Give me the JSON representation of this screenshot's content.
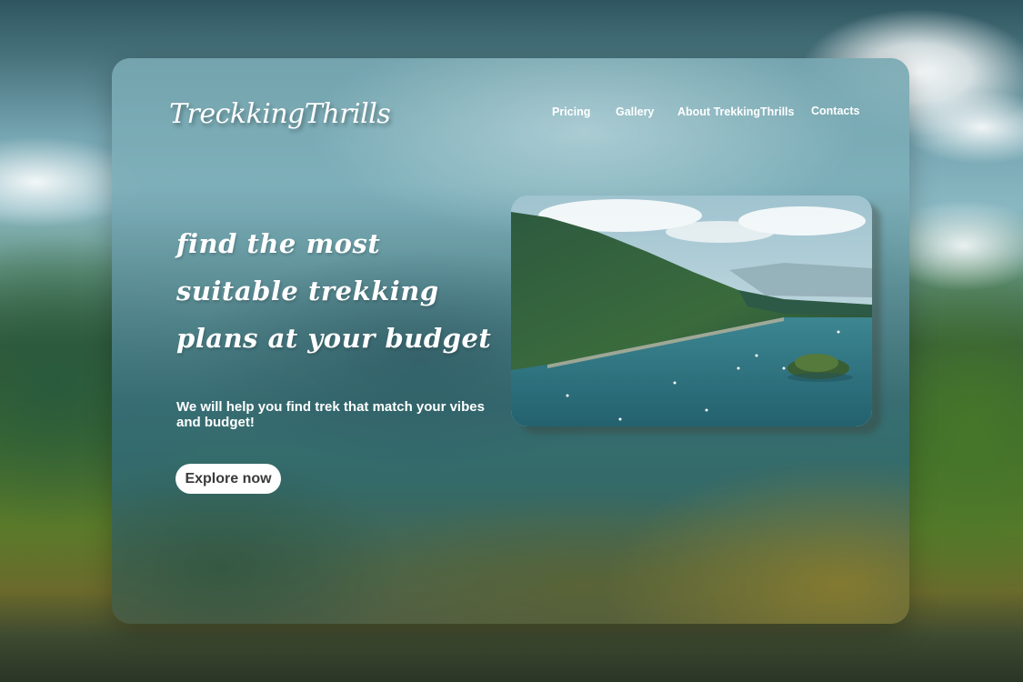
{
  "brand": {
    "logo_text": "TreckkingThrills"
  },
  "nav": {
    "items": [
      {
        "label": "Pricing"
      },
      {
        "label": "Gallery"
      },
      {
        "label": "About TrekkingThrills"
      },
      {
        "label": "Contacts"
      }
    ]
  },
  "hero": {
    "headline": "find the most suitable trekking plans at your budget",
    "subtext": "We will help you find trek that match your vibes and budget!",
    "cta_label": "Explore now"
  },
  "colors": {
    "cta_background": "#ffffff",
    "cta_text": "#3a3a3a",
    "text_primary": "#ffffff"
  },
  "icons": {
    "hero_image": "lake-forest-landscape-photo"
  }
}
